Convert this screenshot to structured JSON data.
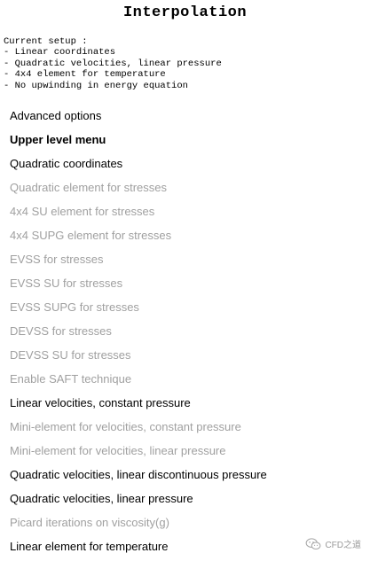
{
  "title": "Interpolation",
  "setup": {
    "heading": "Current setup :",
    "lines": [
      "- Linear coordinates",
      "- Quadratic velocities, linear pressure",
      "- 4x4 element for temperature",
      "- No upwinding in energy equation"
    ]
  },
  "menu": [
    {
      "label": "Advanced options",
      "enabled": true,
      "bold": false
    },
    {
      "label": "Upper level menu",
      "enabled": true,
      "bold": true
    },
    {
      "label": "Quadratic coordinates",
      "enabled": true,
      "bold": false
    },
    {
      "label": "Quadratic element for stresses",
      "enabled": false,
      "bold": false
    },
    {
      "label": "4x4 SU element for stresses",
      "enabled": false,
      "bold": false
    },
    {
      "label": "4x4 SUPG element for stresses",
      "enabled": false,
      "bold": false
    },
    {
      "label": "EVSS for stresses",
      "enabled": false,
      "bold": false
    },
    {
      "label": "EVSS SU for stresses",
      "enabled": false,
      "bold": false
    },
    {
      "label": "EVSS SUPG for stresses",
      "enabled": false,
      "bold": false
    },
    {
      "label": "DEVSS for stresses",
      "enabled": false,
      "bold": false
    },
    {
      "label": "DEVSS SU for stresses",
      "enabled": false,
      "bold": false
    },
    {
      "label": "Enable SAFT technique",
      "enabled": false,
      "bold": false
    },
    {
      "label": "Linear velocities, constant pressure",
      "enabled": true,
      "bold": false
    },
    {
      "label": "Mini-element for velocities, constant pressure",
      "enabled": false,
      "bold": false
    },
    {
      "label": "Mini-element for velocities, linear pressure",
      "enabled": false,
      "bold": false
    },
    {
      "label": "Quadratic velocities, linear discontinuous pressure",
      "enabled": true,
      "bold": false
    },
    {
      "label": "Quadratic velocities, linear pressure",
      "enabled": true,
      "bold": false
    },
    {
      "label": "Picard iterations on viscosity(g)",
      "enabled": false,
      "bold": false
    },
    {
      "label": "Linear element for temperature",
      "enabled": true,
      "bold": false
    }
  ],
  "watermark": {
    "text": "CFD之道",
    "icon": "wechat-icon"
  }
}
